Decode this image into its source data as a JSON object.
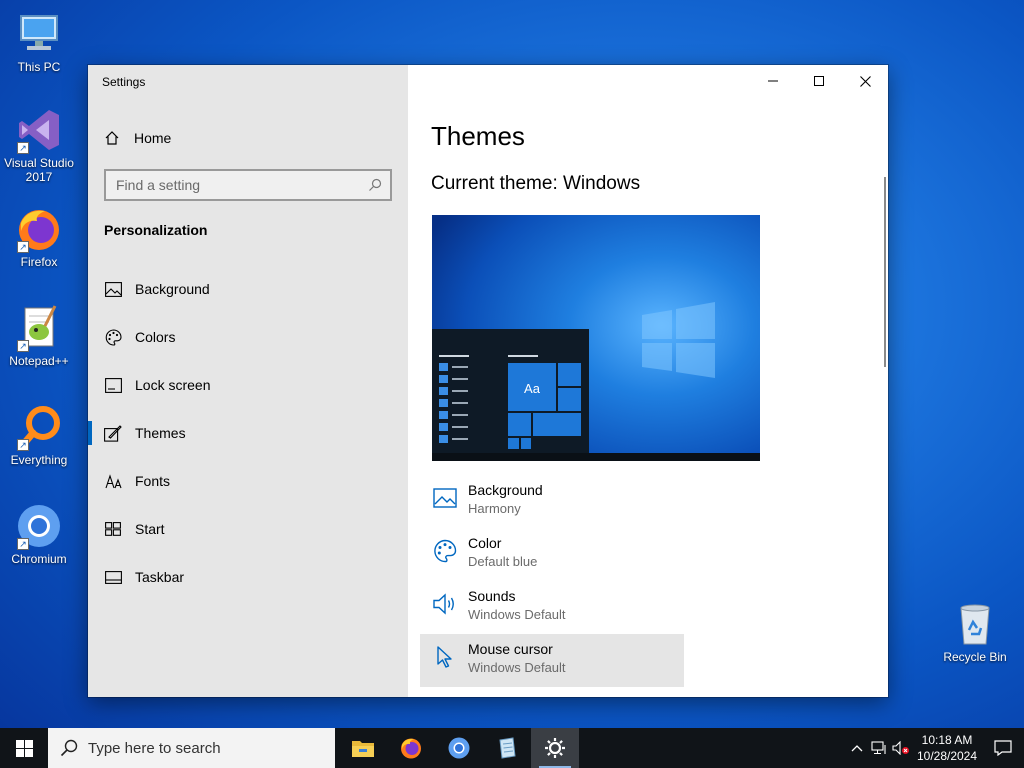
{
  "desktop": {
    "icons": [
      {
        "label": "This PC"
      },
      {
        "label": "Visual Studio 2017"
      },
      {
        "label": "Firefox"
      },
      {
        "label": "Notepad++"
      },
      {
        "label": "Everything"
      },
      {
        "label": "Chromium"
      },
      {
        "label": "Recycle Bin"
      }
    ]
  },
  "window": {
    "title": "Settings",
    "controls": [
      "minimize-icon",
      "maximize-icon",
      "close-icon"
    ]
  },
  "sidebar": {
    "home_label": "Home",
    "search_placeholder": "Find a setting",
    "section_title": "Personalization",
    "items": [
      {
        "label": "Background",
        "icon": "picture-icon"
      },
      {
        "label": "Colors",
        "icon": "palette-icon"
      },
      {
        "label": "Lock screen",
        "icon": "lock-screen-icon"
      },
      {
        "label": "Themes",
        "icon": "themes-brush-icon",
        "active": true
      },
      {
        "label": "Fonts",
        "icon": "fonts-icon"
      },
      {
        "label": "Start",
        "icon": "start-grid-icon"
      },
      {
        "label": "Taskbar",
        "icon": "taskbar-icon"
      }
    ]
  },
  "main": {
    "title": "Themes",
    "current_theme": "Current theme: Windows",
    "preview_sample": "Aa",
    "properties": [
      {
        "label": "Background",
        "value": "Harmony",
        "icon": "picture-icon"
      },
      {
        "label": "Color",
        "value": "Default blue",
        "icon": "palette-icon"
      },
      {
        "label": "Sounds",
        "value": "Windows Default",
        "icon": "speaker-icon"
      },
      {
        "label": "Mouse cursor",
        "value": "Windows Default",
        "icon": "cursor-icon",
        "hover": true
      }
    ]
  },
  "taskbar": {
    "search_placeholder": "Type here to search",
    "apps": [
      "file-explorer-icon",
      "firefox-icon",
      "chromium-icon",
      "notepad-icon",
      "settings-gear-icon"
    ],
    "clock_time": "10:18 AM",
    "clock_date": "10/28/2024"
  },
  "colors": {
    "accent": "#0067c0",
    "sidebar_bg": "#e6e6e6",
    "taskbar_bg": "#101418"
  }
}
